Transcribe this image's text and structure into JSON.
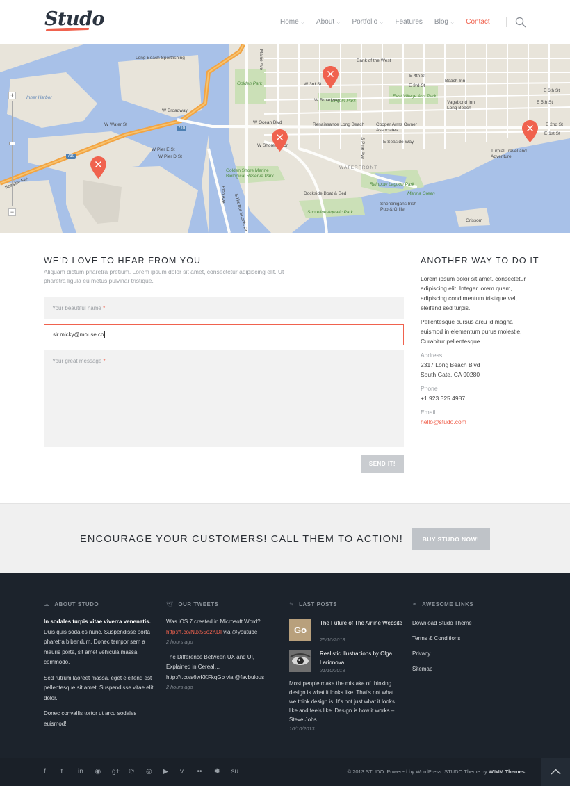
{
  "header": {
    "logo": "Studo",
    "nav": [
      {
        "label": "Home",
        "dropdown": true,
        "active": false
      },
      {
        "label": "About",
        "dropdown": true,
        "active": false
      },
      {
        "label": "Portfolio",
        "dropdown": true,
        "active": false
      },
      {
        "label": "Features",
        "dropdown": false,
        "active": false
      },
      {
        "label": "Blog",
        "dropdown": true,
        "active": false
      },
      {
        "label": "Contact",
        "dropdown": false,
        "active": true
      }
    ],
    "search_icon": "search-icon"
  },
  "map": {
    "labels": {
      "long_beach_sportfishing": "Long Beach Sportfishing",
      "inner_harbor": "Inner Harbor",
      "w_broadway_left": "W Broadway",
      "w_water_st": "W Water St",
      "w_pier_e_st": "W Pier E St",
      "w_pier_d_st": "W Pier D St",
      "seaside_fwy": "Seaside Fwy",
      "pier_c_st": "W Pier C St",
      "pier_j_st": "W Pier J St",
      "golden_park": "Golden Park",
      "w_3rd_st": "W 3rd St",
      "w_ocean_blvd": "W Ocean Blvd",
      "w_shoreline_dr": "W Shoreline Dr",
      "golden_shore": "Golden Shore Marine Biological Reserve Park",
      "pico_ave": "Pico Ave",
      "harbor_scenic": "S Harbor Scenic Dr",
      "bank_of_the_west": "Bank of the West",
      "e_3rd_st": "E 3rd St",
      "e_4th_st": "E 4th St",
      "beach_inn": "Beach Inn",
      "east_village": "East Village Arts Park",
      "w_broadway": "W Broadway",
      "lincoln_park": "Lincoln Park",
      "vagabond_inn": "Vagabond Inn Long Beach",
      "renaissance": "Renaissance Long Beach",
      "cooper_arms": "Cooper Arms Owner Associates",
      "e_seaside_way": "E Seaside Way",
      "waterfront": "WATERFRONT",
      "rainbow_lagoon": "Rainbow Lagoon Park",
      "marina_green": "Marina Green",
      "dockside": "Dockside Boat & Bed",
      "shenanigans": "Shenanigans Irish Pub & Grille",
      "shoreline_aquatic": "Shoreline Aquatic Park",
      "turpial": "Turpial Travel and Adventure",
      "grissom": "Grissom",
      "hwy_710": "710",
      "maine_ave": "Maine Ave",
      "pine_ave": "S Pine Ave",
      "e_1st_st": "E 1st St",
      "e_2nd_st": "E 2nd St",
      "e_5th_st": "E 5th St",
      "e_6th_st": "E 6th St"
    },
    "zoom_plus": "+",
    "zoom_minus": "−"
  },
  "contact": {
    "title": "WE'D LOVE TO HEAR FROM YOU",
    "intro": "Aliquam dictum pharetra pretium. Lorem ipsum dolor sit amet, consectetur adipiscing elit. Ut pharetra ligula eu metus pulvinar tristique.",
    "name_placeholder": "Your beautiful name",
    "email_value": "sir.micky@mouse.co",
    "message_placeholder": "Your great message",
    "required_mark": "*",
    "send_label": "SEND IT!"
  },
  "aside": {
    "title": "ANOTHER WAY TO DO IT",
    "p1": "Lorem ipsum dolor sit amet, consectetur adipiscing elit. Integer lorem quam, adipiscing condimentum tristique vel, eleifend sed turpis.",
    "p2": "Pellentesque cursus arcu id magna euismod in elementum purus molestie. Curabitur pellentesque.",
    "address_label": "Address",
    "address_line1": "2317 Long Beach Blvd",
    "address_line2": "South Gate, CA 90280",
    "phone_label": "Phone",
    "phone": "+1 923 325 4987",
    "email_label": "Email",
    "email": "hello@studo.com"
  },
  "cta": {
    "text": "ENCOURAGE YOUR CUSTOMERS! CALL THEM TO ACTION!",
    "button": "BUY STUDO NOW!"
  },
  "footer": {
    "about": {
      "title": "ABOUT STUDO",
      "p1_bold": "In sodales turpis vitae viverra venenatis.",
      "p1_rest": " Duis quis sodales nunc. Suspendisse porta pharetra bibendum. Donec tempor sem a mauris porta, sit amet vehicula massa commodo.",
      "p2": "Sed rutrum laoreet massa, eget eleifend est pellentesque sit amet. Suspendisse vitae elit dolor.",
      "p3": "Donec convallis tortor ut arcu sodales euismod!"
    },
    "tweets": {
      "title": "OUR TWEETS",
      "items": [
        {
          "text": "Was iOS 7 created in Microsoft Word?",
          "link": "http://t.co/NJx55o2KDI",
          "via": " via ",
          "handle": "@youtube",
          "time": "2 hours ago"
        },
        {
          "text": "The Difference Between UX and UI, Explained in Cereal…",
          "link": "http://t.co/s6wKKFkqGb",
          "via": " via ",
          "handle": "@favbulous",
          "time": "2 hours ago"
        }
      ]
    },
    "posts": {
      "title": "LAST POSTS",
      "items": [
        {
          "thumb": "Go",
          "title": "The Future of The Airline Website",
          "date": "25/10/2013"
        },
        {
          "thumb": "",
          "title": "Realistic illustracions by Olga Larionova",
          "date": "21/10/2013"
        }
      ],
      "quote": "Most people make the mistake of thinking design is what it looks like. That's not what we think design is. It's not just what it looks like and feels like. Design is how it works – Steve Jobs",
      "quote_date": "10/10/2013"
    },
    "links": {
      "title": "AWESOME LINKS",
      "items": [
        "Download Studo Theme",
        "Terms & Conditions",
        "Privacy",
        "Sitemap"
      ]
    }
  },
  "bottom": {
    "social": [
      "facebook-icon",
      "twitter-icon",
      "linkedin-icon",
      "rss-icon",
      "google-plus-icon",
      "pinterest-icon",
      "dribbble-icon",
      "youtube-icon",
      "vimeo-icon",
      "flickr-icon",
      "yelp-icon",
      "stumbleupon-icon"
    ],
    "social_glyphs": [
      "f",
      "t",
      "in",
      "◉",
      "g+",
      "℗",
      "◎",
      "▶",
      "v",
      "••",
      "✱",
      "su"
    ],
    "copyright_prefix": "© 2013 STUDO. Powered by WordPress. STUDO Theme by ",
    "copyright_brand": "WIMM Themes.",
    "to_top_icon": "chevron-up-icon"
  }
}
